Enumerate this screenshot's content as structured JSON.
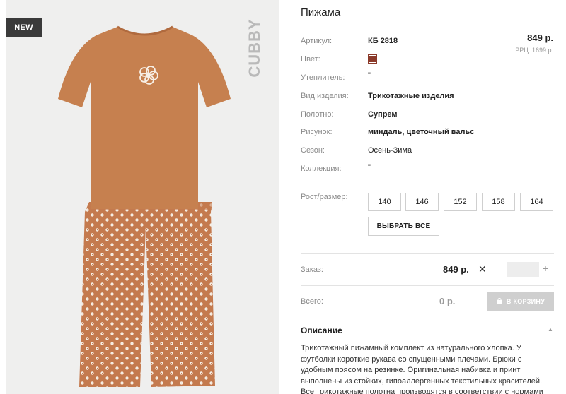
{
  "badge": "NEW",
  "brand": "CUBBY",
  "product": {
    "title": "Пижама",
    "price": "849 р.",
    "rrp": "РРЦ: 1699 р.",
    "color_hex": "#8b3a2a"
  },
  "attributes": [
    {
      "label": "Артикул:",
      "value": "КБ 2818"
    },
    {
      "label": "Цвет:",
      "value": ""
    },
    {
      "label": "Утеплитель:",
      "value": "\""
    },
    {
      "label": "Вид изделия:",
      "value": "Трикотажные изделия"
    },
    {
      "label": "Полотно:",
      "value": "Супрем"
    },
    {
      "label": "Рисунок:",
      "value": "миндаль, цветочный вальс"
    },
    {
      "label": "Сезон:",
      "value": "Осень-Зима"
    },
    {
      "label": "Коллекция:",
      "value": "\""
    }
  ],
  "sizes": {
    "label": "Рост/размер:",
    "options": [
      "140",
      "146",
      "152",
      "158",
      "164"
    ],
    "select_all": "ВЫБРАТЬ ВСЕ"
  },
  "order": {
    "label": "Заказ:",
    "price": "849 р.",
    "times": "✕",
    "minus": "–",
    "plus": "+",
    "quantity": ""
  },
  "total": {
    "label": "Всего:",
    "value": "0 р.",
    "cart_button": "В КОРЗИНУ"
  },
  "description": {
    "heading": "Описание",
    "toggle": "▲",
    "text": "Трикотажный пижамный комплект из натурального хлопка. У футболки короткие рукава со спущенными плечами. Брюки с удобным поясом на резинке. Оригинальная набивка и принт выполнены из стойких, гипоаллергенных текстильных красителей. Все трикотажные полотна производятся в соответствии с нормами"
  },
  "icons": {
    "times": "close-icon",
    "cart": "cart-icon",
    "toggle": "chevron-up-icon"
  }
}
